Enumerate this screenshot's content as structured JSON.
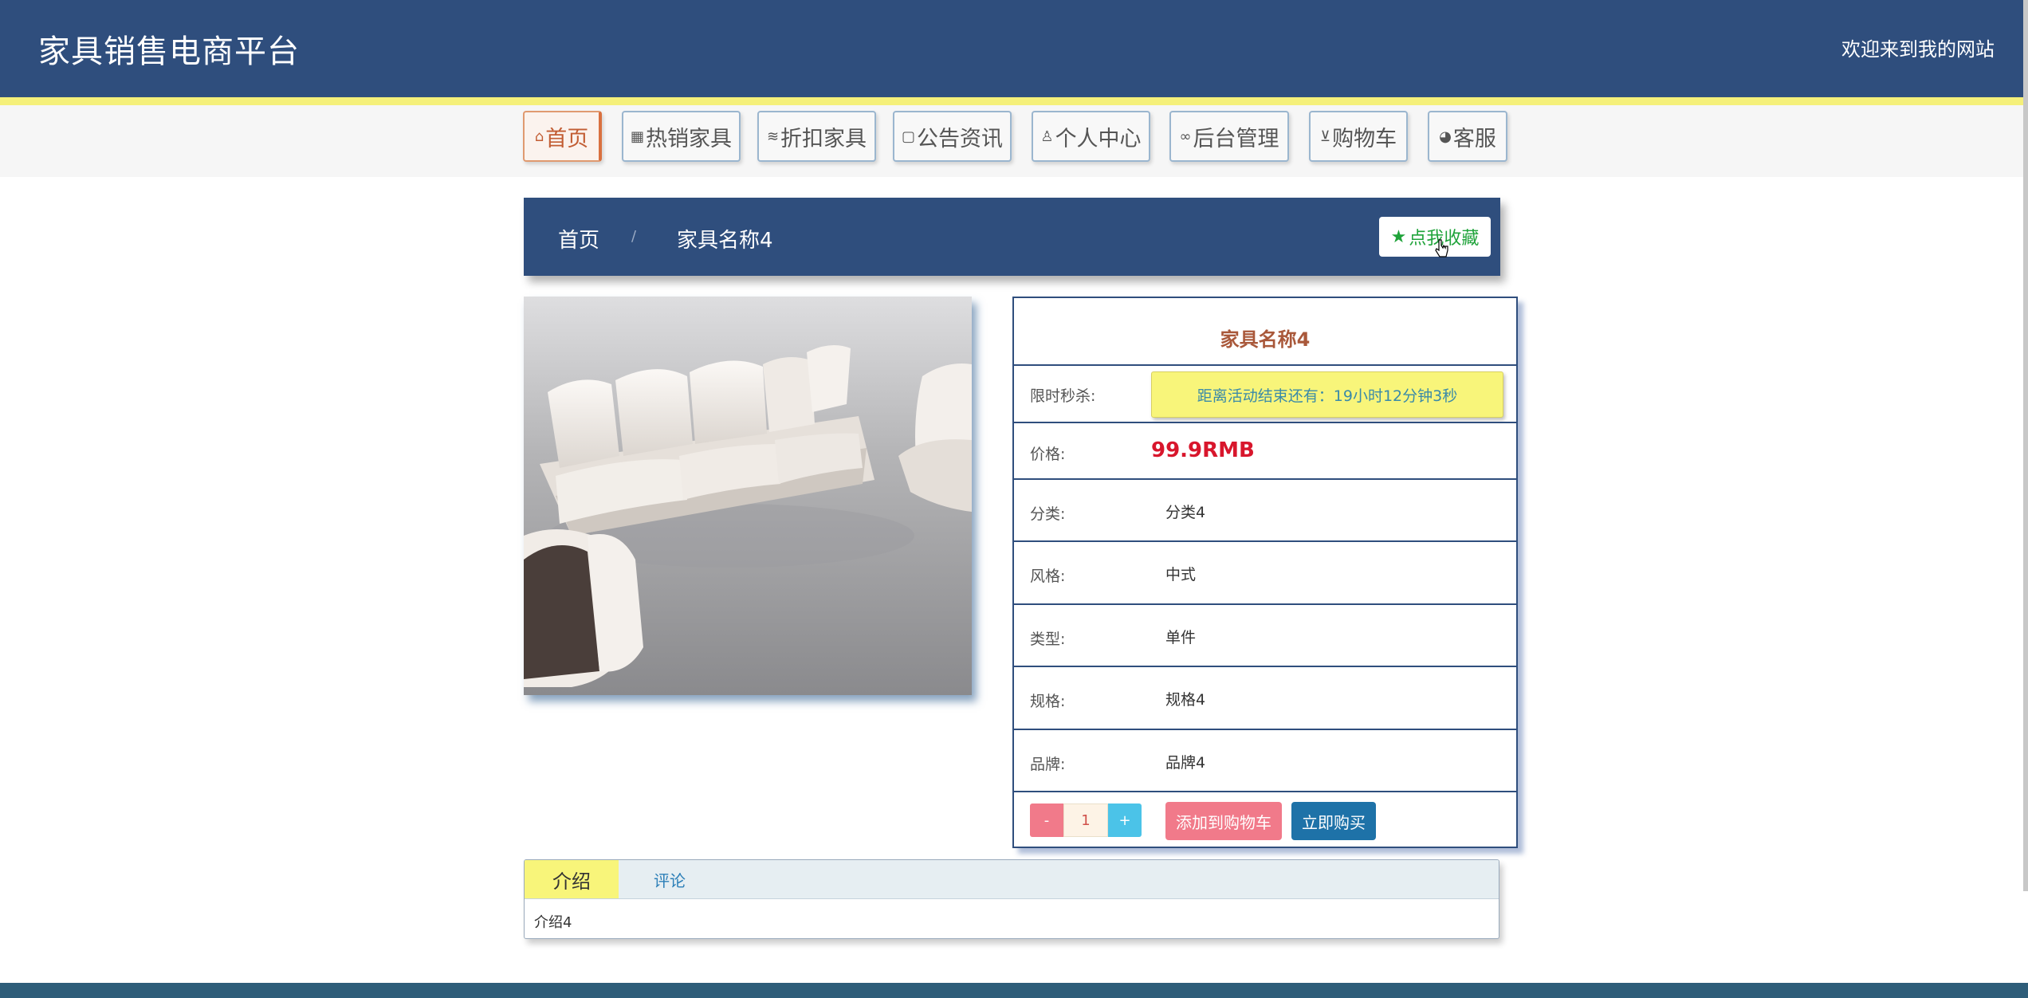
{
  "header": {
    "title": "家具销售电商平台",
    "welcome": "欢迎来到我的网站"
  },
  "nav": {
    "items": [
      {
        "label": "首页",
        "icon": "home-icon",
        "active": true
      },
      {
        "label": "热销家具",
        "icon": "gift-icon"
      },
      {
        "label": "折扣家具",
        "icon": "layers-icon"
      },
      {
        "label": "公告资讯",
        "icon": "note-icon"
      },
      {
        "label": "个人中心",
        "icon": "user-icon"
      },
      {
        "label": "后台管理",
        "icon": "link-icon"
      },
      {
        "label": "购物车",
        "icon": "cart-icon"
      },
      {
        "label": "客服",
        "icon": "chat-icon"
      }
    ]
  },
  "breadcrumb": {
    "home": "首页",
    "separator": "/",
    "current": "家具名称4",
    "favorite_label": "点我收藏"
  },
  "product": {
    "name": "家具名称4",
    "flash_sale_label": "限时秒杀:",
    "countdown_text": "距离活动结束还有：19小时12分钟3秒",
    "price_label": "价格:",
    "price": "99.9RMB",
    "fields": [
      {
        "label": "分类:",
        "value": "分类4"
      },
      {
        "label": "风格:",
        "value": "中式"
      },
      {
        "label": "类型:",
        "value": "单件"
      },
      {
        "label": "规格:",
        "value": "规格4"
      },
      {
        "label": "品牌:",
        "value": "品牌4"
      }
    ],
    "quantity": "1",
    "minus_label": "-",
    "plus_label": "+",
    "add_to_cart_label": "添加到购物车",
    "buy_now_label": "立即购买"
  },
  "tabs": {
    "active": "介绍",
    "other": "评论",
    "content": "介绍4"
  },
  "colors": {
    "primary": "#2f4e7d",
    "accent_yellow": "#f8f57a",
    "price_red": "#d8162c",
    "favorite_green": "#1fa33a",
    "cart_pink": "#f17a8a",
    "buy_blue": "#1e72a8"
  }
}
